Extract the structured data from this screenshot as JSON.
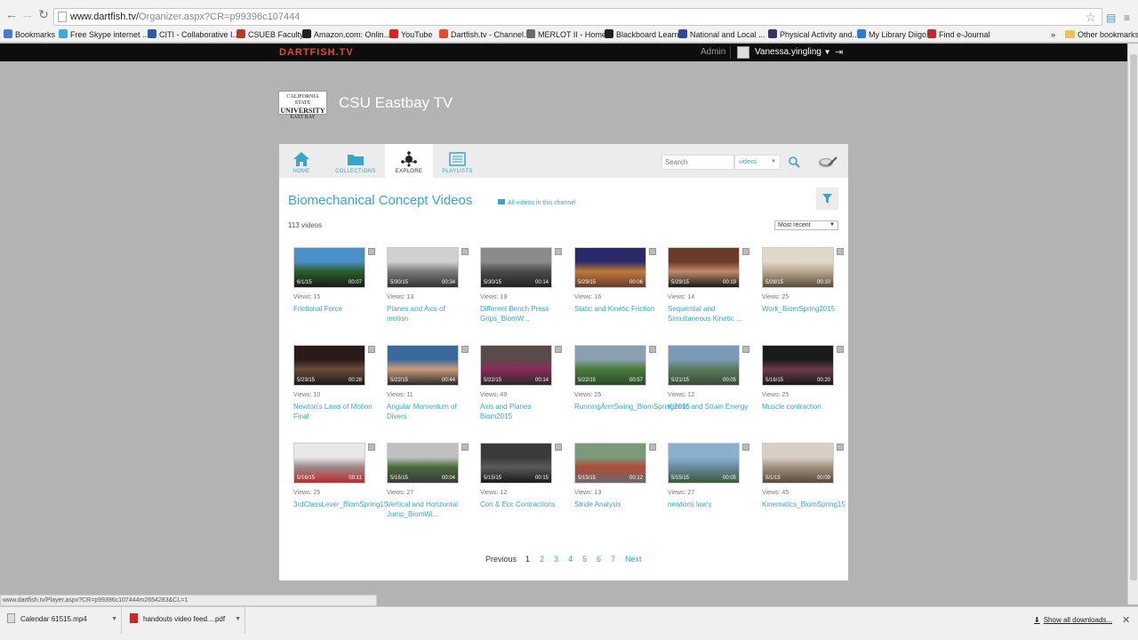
{
  "browser": {
    "url_main": "www.dartfish.tv/",
    "url_rest": "Organizer.aspx?CR=p99396c107444",
    "bookmarks": [
      {
        "label": "Bookmarks",
        "color": "#4a7bd1"
      },
      {
        "label": "Free Skype internet ...",
        "color": "#3aa8e5"
      },
      {
        "label": "CITI - Collaborative I...",
        "color": "#2b5d9b"
      },
      {
        "label": "CSUEB Faculty",
        "color": "#b53a2a"
      },
      {
        "label": "Amazon.com: Onlin...",
        "color": "#222222"
      },
      {
        "label": "YouTube",
        "color": "#e02020"
      },
      {
        "label": "Dartfish.tv - Channel...",
        "color": "#e8492a"
      },
      {
        "label": "MERLOT II - Home",
        "color": "#6a6a6a"
      },
      {
        "label": "Blackboard Learn",
        "color": "#222222"
      },
      {
        "label": "National and Local ...",
        "color": "#2a4a9b"
      },
      {
        "label": "Physical Activity and...",
        "color": "#333366"
      },
      {
        "label": "My Library Diigo",
        "color": "#2f78d1"
      },
      {
        "label": "Find e-Journal",
        "color": "#c02a2a"
      }
    ],
    "other_bookmarks": "Other bookmarks",
    "more": "»"
  },
  "site": {
    "logo": "DARTFISH.TV",
    "admin": "Admin",
    "username": "Vanessa.yingling",
    "caret": "▼"
  },
  "channel": {
    "logo_top": "CALIFORNIA STATE",
    "logo_mid": "UNIVERSITY",
    "logo_bot": "EAST BAY",
    "title": "CSU Eastbay TV"
  },
  "tabs": [
    {
      "label": "HOME",
      "icon": "home-icon"
    },
    {
      "label": "COLLECTIONS",
      "icon": "folder-icon"
    },
    {
      "label": "EXPLORE",
      "icon": "explore-icon"
    },
    {
      "label": "PLAYLISTS",
      "icon": "playlist-icon"
    }
  ],
  "search": {
    "placeholder": "Search",
    "type": "videos"
  },
  "page": {
    "heading": "Biomechanical Concept Videos",
    "all_link": "All videos in this channel",
    "count": "113 videos",
    "sort": "Most recent"
  },
  "videos": [
    {
      "date": "6/1/15",
      "duration": "00:07",
      "views": "Views: 15",
      "title": "Frictional Force",
      "colors": [
        "#4a90c8",
        "#2a5f2a",
        "#1a1a1a"
      ]
    },
    {
      "date": "5/30/15",
      "duration": "00:34",
      "views": "Views: 13",
      "title": "Planes and Axis of motion",
      "colors": [
        "#d0d0d0",
        "#7a7a7a",
        "#333333"
      ]
    },
    {
      "date": "5/30/15",
      "duration": "00:14",
      "views": "Views: 19",
      "title": "Different Bench Press Grips_BiomW...",
      "colors": [
        "#8a8a8a",
        "#4a4a4a",
        "#222222"
      ]
    },
    {
      "date": "5/29/15",
      "duration": "00:06",
      "views": "Views: 16",
      "title": "Static and Kinetic Friction",
      "colors": [
        "#2a2a6a",
        "#c07a3a",
        "#6a3a2a"
      ]
    },
    {
      "date": "5/29/15",
      "duration": "00:19",
      "views": "Views: 14",
      "title": "Sequential and Simultaneous Kinetic ...",
      "colors": [
        "#6a3a2a",
        "#c08a6a",
        "#1a1a1a"
      ]
    },
    {
      "date": "5/28/15",
      "duration": "00:10",
      "views": "Views: 25",
      "title": "Work_BiomSpring2015",
      "colors": [
        "#e0d8c8",
        "#b8a890",
        "#5a4a3a"
      ]
    },
    {
      "date": "5/23/15",
      "duration": "00:28",
      "views": "Views: 10",
      "title": "Newton's Laws of Motion Final",
      "colors": [
        "#2a1a1a",
        "#6a4a3a",
        "#1a1a1a"
      ]
    },
    {
      "date": "5/22/15",
      "duration": "00:44",
      "views": "Views: 11",
      "title": "Angular Momentum of Divers",
      "colors": [
        "#3a6a9a",
        "#c89a7a",
        "#2a2a2a"
      ]
    },
    {
      "date": "5/22/15",
      "duration": "00:14",
      "views": "Views: 49",
      "title": "Axis and Planes Biom2015",
      "colors": [
        "#5a4a4a",
        "#8a2a5a",
        "#2a2a2a"
      ]
    },
    {
      "date": "5/22/15",
      "duration": "00:57",
      "views": "Views: 25",
      "title": "RunningArmSwing_BiomSpring2015",
      "colors": [
        "#8aa0b0",
        "#4a7a3a",
        "#2a4a2a"
      ]
    },
    {
      "date": "5/21/15",
      "duration": "00:05",
      "views": "Views: 12",
      "title": "Kinetic and Strain Energy",
      "colors": [
        "#7a9ab8",
        "#5a7a5a",
        "#3a4a3a"
      ]
    },
    {
      "date": "5/16/15",
      "duration": "00:20",
      "views": "Views: 25",
      "title": "Muscle contraction",
      "colors": [
        "#1a1a1a",
        "#6a3a4a",
        "#1a1a1a"
      ]
    },
    {
      "date": "5/16/15",
      "duration": "00:11",
      "views": "Views: 25",
      "title": "3rdClassLever_BiomSpring15",
      "colors": [
        "#e8e8e8",
        "#9a8a8a",
        "#c02a2a"
      ]
    },
    {
      "date": "5/15/15",
      "duration": "00:04",
      "views": "Views: 27",
      "title": "Vertical and Horizontal Jump_BiomWi...",
      "colors": [
        "#c0c0c0",
        "#4a6a3a",
        "#3a3a3a"
      ]
    },
    {
      "date": "5/15/15",
      "duration": "00:15",
      "views": "Views: 12",
      "title": "Con & Ecc Contractions",
      "colors": [
        "#3a3a3a",
        "#5a5a5a",
        "#1a1a1a"
      ]
    },
    {
      "date": "5/15/15",
      "duration": "00:12",
      "views": "Views: 13",
      "title": "Stride Analysis",
      "colors": [
        "#7a9a7a",
        "#b04a3a",
        "#6a6a6a"
      ]
    },
    {
      "date": "5/15/15",
      "duration": "00:05",
      "views": "Views: 27",
      "title": "newtons law's",
      "colors": [
        "#8ab0d0",
        "#6a8aa0",
        "#3a5a3a"
      ]
    },
    {
      "date": "5/1/15",
      "duration": "00:09",
      "views": "Views: 45",
      "title": "Kinematics_BiomSpring15",
      "colors": [
        "#d8d0c8",
        "#a09080",
        "#5a4a3a"
      ]
    }
  ],
  "pagination": {
    "previous": "Previous",
    "pages": [
      "1",
      "2",
      "3",
      "4",
      "5",
      "6",
      "7"
    ],
    "current": "1",
    "next": "Next"
  },
  "status_url": "www.dartfish.tv/Player.aspx?CR=p99396c107444m2654283&CL=1",
  "downloads": {
    "items": [
      {
        "label": "Calendar 61515.mp4"
      },
      {
        "label": "handouts video feed....pdf"
      }
    ],
    "show_all": "Show all downloads..."
  },
  "colors": {
    "accent": "#39a6c9",
    "brand": "#e8492a",
    "background": "#b3b3b3"
  }
}
